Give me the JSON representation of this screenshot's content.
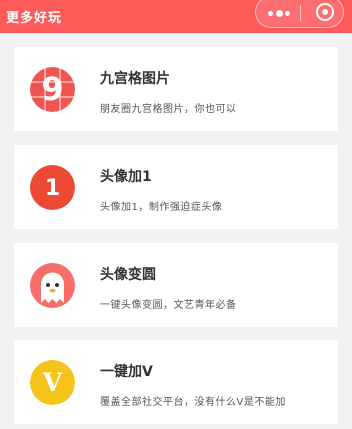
{
  "header": {
    "title": "更多好玩",
    "more_icon": "more-dots-icon",
    "close_icon": "close-circle-icon",
    "color": "#ff5a5a"
  },
  "items": [
    {
      "title": "九宫格图片",
      "desc": "朋友圈九宫格图片，你也可以",
      "icon": "nine-grid-icon",
      "icon_glyph": "9",
      "color": "#f2554f"
    },
    {
      "title": "头像加1",
      "desc": "头像加1，制作强迫症头像",
      "icon": "badge-one-icon",
      "icon_glyph": "1",
      "color": "#ec4a35"
    },
    {
      "title": "头像变圆",
      "desc": "一键头像变圆，文艺青年必备",
      "icon": "ghost-avatar-icon",
      "color": "#f76d6a"
    },
    {
      "title": "一键加V",
      "desc": "覆盖全部社交平台，没有什么V是不能加",
      "icon": "v-badge-icon",
      "icon_glyph": "V",
      "color": "#f5c319"
    }
  ]
}
